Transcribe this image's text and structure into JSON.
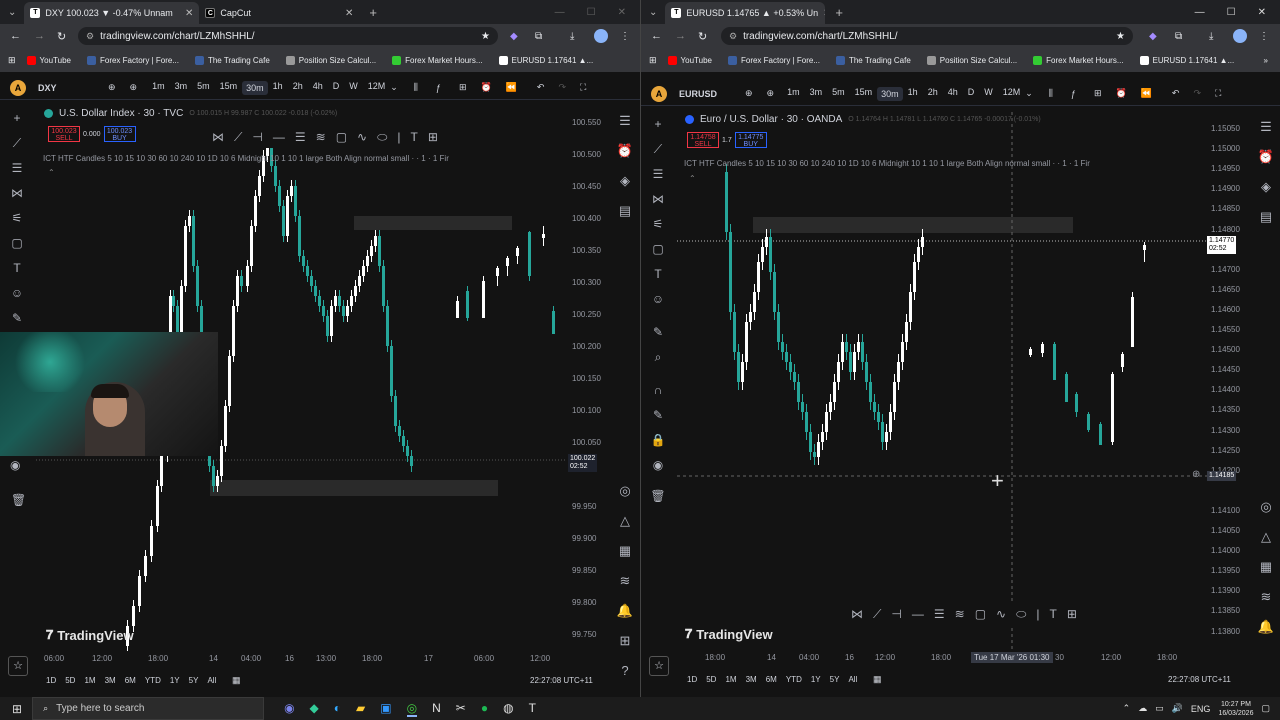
{
  "left_browser": {
    "tabs": [
      {
        "label": "DXY 100.023 ▼ -0.47% Unnam",
        "icon": "tradingview-icon",
        "active": true
      },
      {
        "label": "CapCut",
        "icon": "capcut-icon",
        "active": false
      }
    ],
    "url": "tradingview.com/chart/LZMhSHHL/",
    "bookmarks": [
      "YouTube",
      "Forex Factory | Fore...",
      "The Trading Cafe",
      "Position Size Calcul...",
      "Forex Market Hours...",
      "EURUSD 1.17641 ▲..."
    ],
    "symbol": "DXY",
    "timeframes": [
      "1m",
      "3m",
      "5m",
      "15m",
      "30m",
      "1h",
      "2h",
      "4h",
      "D",
      "W",
      "12M"
    ],
    "active_timeframe": "30m",
    "legend_title": "U.S. Dollar Index · 30 · TVC",
    "ohlc": "O 100.015 H 99.987 C 100.022 -0.018 (-0.02%)",
    "sell_price": "100.023",
    "sell_label": "SELL",
    "spread": "0.000",
    "buy_price": "100.023",
    "buy_label": "BUY",
    "indicator": "ICT HTF Candles  5 10 15 10 30 60 10 240 10 1D 10 6 Midnight 10 1 10 1 large Both Align normal small · · 1 · 1 Fir",
    "prices": [
      "100.550",
      "100.500",
      "100.450",
      "100.400",
      "100.350",
      "100.300",
      "100.250",
      "100.200",
      "100.150",
      "100.100",
      "100.050",
      "99.950",
      "99.900",
      "99.850",
      "99.800",
      "99.750"
    ],
    "current_price": "100.022",
    "countdown": "02:52",
    "time_labels": [
      "06:00",
      "12:00",
      "18:00",
      "14",
      "04:00",
      "16",
      "13:00",
      "18:00",
      "17",
      "06:00",
      "12:00"
    ],
    "ranges": [
      "1D",
      "5D",
      "1M",
      "3M",
      "6M",
      "YTD",
      "1Y",
      "5Y",
      "All"
    ],
    "clock": "22:27:08 UTC+11",
    "watermark": "TradingView"
  },
  "right_browser": {
    "tabs": [
      {
        "label": "EURUSD 1.14765 ▲ +0.53% Un",
        "icon": "tradingview-icon",
        "active": true
      }
    ],
    "url": "tradingview.com/chart/LZMhSHHL/",
    "bookmarks": [
      "YouTube",
      "Forex Factory | Fore...",
      "The Trading Cafe",
      "Position Size Calcul...",
      "Forex Market Hours...",
      "EURUSD 1.17641 ▲..."
    ],
    "symbol": "EURUSD",
    "timeframes": [
      "1m",
      "3m",
      "5m",
      "15m",
      "30m",
      "1h",
      "2h",
      "4h",
      "D",
      "W",
      "12M"
    ],
    "active_timeframe": "30m",
    "legend_title": "Euro / U.S. Dollar · 30 · OANDA",
    "ohlc": "O 1.14764 H 1.14781 L 1.14760 C 1.14765 -0.00017 (-0.01%)",
    "sell_price": "1.14758",
    "sell_label": "SELL",
    "spread": "1.7",
    "buy_price": "1.14775",
    "buy_label": "BUY",
    "indicator": "ICT HTF Candles  5 10 15 10 30 60 10 240 10 1D 10 6 Midnight 10 1 10 1 large Both Align normal small · · 1 · 1 Fir",
    "prices": [
      "1.15050",
      "1.15000",
      "1.14950",
      "1.14900",
      "1.14850",
      "1.14800",
      "1.14700",
      "1.14650",
      "1.14600",
      "1.14550",
      "1.14500",
      "1.14450",
      "1.14400",
      "1.14350",
      "1.14300",
      "1.14250",
      "1.14200",
      "1.14100",
      "1.14050",
      "1.14000",
      "1.13950",
      "1.13900",
      "1.13850",
      "1.13800"
    ],
    "current_price": "1.14770",
    "countdown": "02:52",
    "crosshair_price": "1.14185",
    "time_labels": [
      "18:00",
      "14",
      "04:00",
      "16",
      "12:00",
      "18:00",
      "30",
      "12:00",
      "18:00"
    ],
    "crosshair_time": "Tue 17 Mar '26   01:30",
    "ranges": [
      "1D",
      "5D",
      "1M",
      "3M",
      "6M",
      "YTD",
      "1Y",
      "5Y",
      "All"
    ],
    "clock": "22:27:08 UTC+11",
    "watermark": "TradingView"
  },
  "taskbar": {
    "search_placeholder": "Type here to search",
    "time": "10:27 PM",
    "date": "16/03/2026",
    "lang": "ENG"
  },
  "colors": {
    "up": "#ffffff",
    "down": "#26a69a",
    "sell": "#f23645",
    "buy": "#2962ff"
  }
}
